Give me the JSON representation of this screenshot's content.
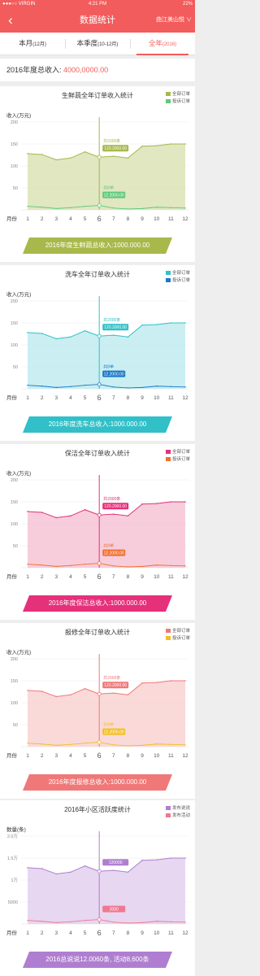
{
  "status_bar": {
    "carrier": "●●●○○ VIRGIN",
    "time": "4:21 PM",
    "battery": "22%"
  },
  "nav": {
    "back_icon": "‹",
    "title": "数据统计",
    "location": "曲江美山悦 ∨"
  },
  "tabs": [
    {
      "label": "本月",
      "sub": "(12月)",
      "active": false
    },
    {
      "label": "本季度",
      "sub": "(10-12月)",
      "active": false
    },
    {
      "label": "全年",
      "sub": "(2016)",
      "active": true
    }
  ],
  "summary": {
    "label": "2016年度总收入: ",
    "value": "4000,0000.00"
  },
  "chart_data": [
    {
      "type": "area",
      "title": "生鲜蔬全年订单收入统计",
      "ylabel": "收入(万元)",
      "xlabel": "月份",
      "categories": [
        "1",
        "2",
        "3",
        "4",
        "5",
        "6",
        "7",
        "8",
        "9",
        "10",
        "11",
        "12"
      ],
      "selected": "6",
      "yticks": [
        "200",
        "150",
        "100",
        "50"
      ],
      "ylim": [
        0,
        200
      ],
      "color": "#a8b84a",
      "fill": "#dbe3b6",
      "series": [
        {
          "name": "全部订单",
          "color": "#a8b84a",
          "values": [
            128,
            126,
            114,
            118,
            132,
            120,
            122,
            118,
            145,
            146,
            150,
            150
          ]
        },
        {
          "name": "投诉订单",
          "color": "#5ec97a",
          "values": [
            8,
            6,
            3,
            5,
            8,
            10,
            4,
            2,
            3,
            6,
            5,
            4
          ]
        }
      ],
      "tooltip_main": {
        "line1": "共2000条",
        "line2": "120.2000.00"
      },
      "tooltip_sub": {
        "line1": "共8单",
        "line2": "12.2000.00"
      },
      "banner": "2016年度生鲜蔬总收入:1000.000.00",
      "banner_color": "#a8b84a"
    },
    {
      "type": "area",
      "title": "洗车全年订单收入统计",
      "ylabel": "收入(万元)",
      "xlabel": "月份",
      "categories": [
        "1",
        "2",
        "3",
        "4",
        "5",
        "6",
        "7",
        "8",
        "9",
        "10",
        "11",
        "12"
      ],
      "selected": "6",
      "yticks": [
        "200",
        "150",
        "100",
        "50"
      ],
      "ylim": [
        0,
        200
      ],
      "color": "#31c0c8",
      "fill": "#c1ebee",
      "series": [
        {
          "name": "全部订单",
          "color": "#31c0c8",
          "values": [
            128,
            126,
            114,
            118,
            132,
            120,
            122,
            118,
            145,
            146,
            150,
            150
          ]
        },
        {
          "name": "投诉订单",
          "color": "#1a78c8",
          "values": [
            8,
            6,
            3,
            5,
            8,
            10,
            4,
            2,
            3,
            6,
            5,
            4
          ]
        }
      ],
      "tooltip_main": {
        "line1": "共2000条",
        "line2": "120.2000.00"
      },
      "tooltip_sub": {
        "line1": "共8单",
        "line2": "12.2000.00"
      },
      "banner": "2016年度洗车总收入:1000.000.00",
      "banner_color": "#31c0c8"
    },
    {
      "type": "area",
      "title": "保洁全年订单收入统计",
      "ylabel": "收入(万元)",
      "xlabel": "月份",
      "categories": [
        "1",
        "2",
        "3",
        "4",
        "5",
        "6",
        "7",
        "8",
        "9",
        "10",
        "11",
        "12"
      ],
      "selected": "6",
      "yticks": [
        "200",
        "150",
        "100",
        "50"
      ],
      "ylim": [
        0,
        200
      ],
      "color": "#e5307a",
      "fill": "#f6c4d6",
      "series": [
        {
          "name": "全部订单",
          "color": "#e5307a",
          "values": [
            128,
            126,
            114,
            118,
            132,
            120,
            122,
            118,
            145,
            146,
            150,
            150
          ]
        },
        {
          "name": "投诉订单",
          "color": "#f07030",
          "values": [
            8,
            6,
            3,
            5,
            8,
            10,
            4,
            2,
            3,
            6,
            5,
            4
          ]
        }
      ],
      "tooltip_main": {
        "line1": "共2000条",
        "line2": "120.2000.00"
      },
      "tooltip_sub": {
        "line1": "共8单",
        "line2": "12.2000.00"
      },
      "banner": "2016年度保洁总收入:1000.000.00",
      "banner_color": "#e5307a"
    },
    {
      "type": "area",
      "title": "报修全年订单收入统计",
      "ylabel": "收入(万元)",
      "xlabel": "月份",
      "categories": [
        "1",
        "2",
        "3",
        "4",
        "5",
        "6",
        "7",
        "8",
        "9",
        "10",
        "11",
        "12"
      ],
      "selected": "6",
      "yticks": [
        "200",
        "150",
        "100",
        "50"
      ],
      "ylim": [
        0,
        200
      ],
      "color": "#f07878",
      "fill": "#f9d2d2",
      "series": [
        {
          "name": "全部订单",
          "color": "#f07878",
          "values": [
            128,
            126,
            114,
            118,
            132,
            120,
            122,
            118,
            145,
            146,
            150,
            150
          ]
        },
        {
          "name": "投诉订单",
          "color": "#f2c020",
          "values": [
            8,
            6,
            3,
            5,
            8,
            10,
            4,
            2,
            3,
            6,
            5,
            4
          ]
        }
      ],
      "tooltip_main": {
        "line1": "共2000条",
        "line2": "120.2000.00"
      },
      "tooltip_sub": {
        "line1": "共8单",
        "line2": "12.2000.00"
      },
      "banner": "2016年度报修总收入:1000.000.00",
      "banner_color": "#f07878"
    },
    {
      "type": "area",
      "title": "2016年小区活跃度统计",
      "ylabel": "数量(条)",
      "xlabel": "月份",
      "categories": [
        "1",
        "2",
        "3",
        "4",
        "5",
        "6",
        "7",
        "8",
        "9",
        "10",
        "11",
        "12"
      ],
      "selected": "6",
      "yticks": [
        "2.0万",
        "1.5万",
        "1万",
        "5000"
      ],
      "ylim": [
        0,
        20000
      ],
      "color": "#b07ed0",
      "fill": "#e3d0ee",
      "series": [
        {
          "name": "发布说说",
          "color": "#b07ed0",
          "values": [
            12800,
            12600,
            11400,
            11800,
            13200,
            12000,
            12200,
            11800,
            14500,
            14600,
            15000,
            15000
          ]
        },
        {
          "name": "发布活动",
          "color": "#f07890",
          "values": [
            800,
            600,
            300,
            500,
            800,
            1000,
            400,
            200,
            300,
            600,
            500,
            400
          ]
        }
      ],
      "tooltip_main": {
        "line1": "",
        "line2": "120000"
      },
      "tooltip_sub": {
        "line1": "",
        "line2": "2000"
      },
      "banner": "2016总说说12.0060条, 活动8,600条",
      "banner_color": "#b07ed0"
    }
  ]
}
